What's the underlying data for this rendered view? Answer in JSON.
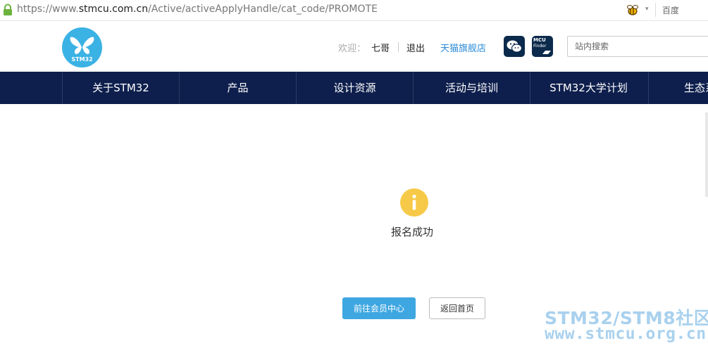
{
  "browser": {
    "url_prefix": "https://www.",
    "url_domain": "stmcu.com.cn",
    "url_path": "/Active/activeApplyHandle/cat_code/PROMOTE",
    "search_engine": "百度",
    "caret": "▾"
  },
  "header": {
    "logo_text": "STM32",
    "welcome_label": "欢迎：",
    "user_name": "七哥",
    "logout": "退出",
    "tmall_store": "天猫旗舰店",
    "mcu_finder_line1": "MCU",
    "mcu_finder_line2": "Finder",
    "search_placeholder": "站内搜索"
  },
  "nav": {
    "items": [
      {
        "label": "关于STM32"
      },
      {
        "label": "产品"
      },
      {
        "label": "设计资源"
      },
      {
        "label": "活动与培训"
      },
      {
        "label": "STM32大学计划"
      },
      {
        "label": "生态系统"
      }
    ]
  },
  "content": {
    "status_text": "报名成功",
    "primary_button": "前往会员中心",
    "secondary_button": "返回首页"
  },
  "watermark": {
    "line1": "STM32/STM8社区",
    "line2": "www.stmcu.org.cn"
  },
  "colors": {
    "nav_background": "#0e1f4d",
    "primary_button": "#3ea7e1",
    "info_icon": "#f7c948",
    "logo": "#3bb2e4"
  }
}
